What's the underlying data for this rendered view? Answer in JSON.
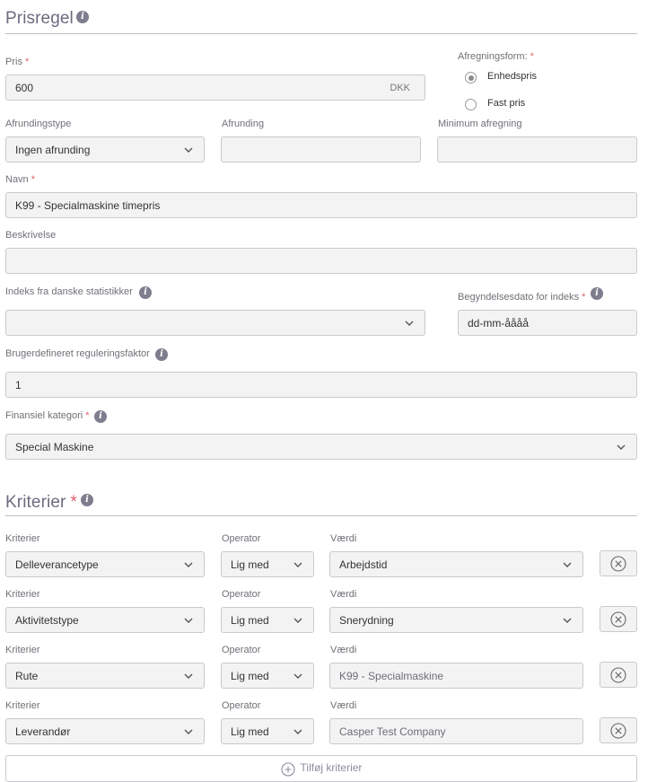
{
  "prisregel": {
    "title": "Prisregel",
    "pris": {
      "label": "Pris",
      "value": "600",
      "unit": "DKK"
    },
    "afregningsform": {
      "label": "Afregningsform:",
      "options": [
        "Enhedspris",
        "Fast pris"
      ],
      "selected": "Enhedspris"
    },
    "afrundingstype": {
      "label": "Afrundingstype",
      "value": "Ingen afrunding"
    },
    "afrunding": {
      "label": "Afrunding",
      "value": ""
    },
    "minimum_afregning": {
      "label": "Minimum afregning",
      "value": ""
    },
    "navn": {
      "label": "Navn",
      "value": "K99 - Specialmaskine timepris"
    },
    "beskrivelse": {
      "label": "Beskrivelse",
      "value": ""
    },
    "indeks": {
      "label": "Indeks fra danske statistikker",
      "value": ""
    },
    "begyndelsesdato": {
      "label": "Begyndelsesdato for indeks",
      "value": "dd-mm-åååå"
    },
    "reguleringsfaktor": {
      "label": "Brugerdefineret reguleringsfaktor",
      "value": "1"
    },
    "finansiel_kategori": {
      "label": "Finansiel kategori",
      "value": "Special Maskine"
    }
  },
  "kriterier": {
    "title": "Kriterier",
    "col_labels": {
      "kriterier": "Kriterier",
      "operator": "Operator",
      "vaerdi": "Værdi"
    },
    "rows": [
      {
        "kriterie": "Delleverancetype",
        "operator": "Lig med",
        "vaerdi": "Arbejdstid"
      },
      {
        "kriterie": "Aktivitetstype",
        "operator": "Lig med",
        "vaerdi": "Snerydning"
      },
      {
        "kriterie": "Rute",
        "operator": "Lig med",
        "vaerdi": "K99 - Specialmaskine"
      },
      {
        "kriterie": "Leverandør",
        "operator": "Lig med",
        "vaerdi": "Casper Test Company"
      }
    ],
    "add_label": "Tilføj kriterier"
  },
  "required_mark": "*",
  "icons": {
    "info": "info-icon",
    "chevron": "chevron-down-icon",
    "remove": "close-circle-icon",
    "add": "plus-circle-icon"
  }
}
